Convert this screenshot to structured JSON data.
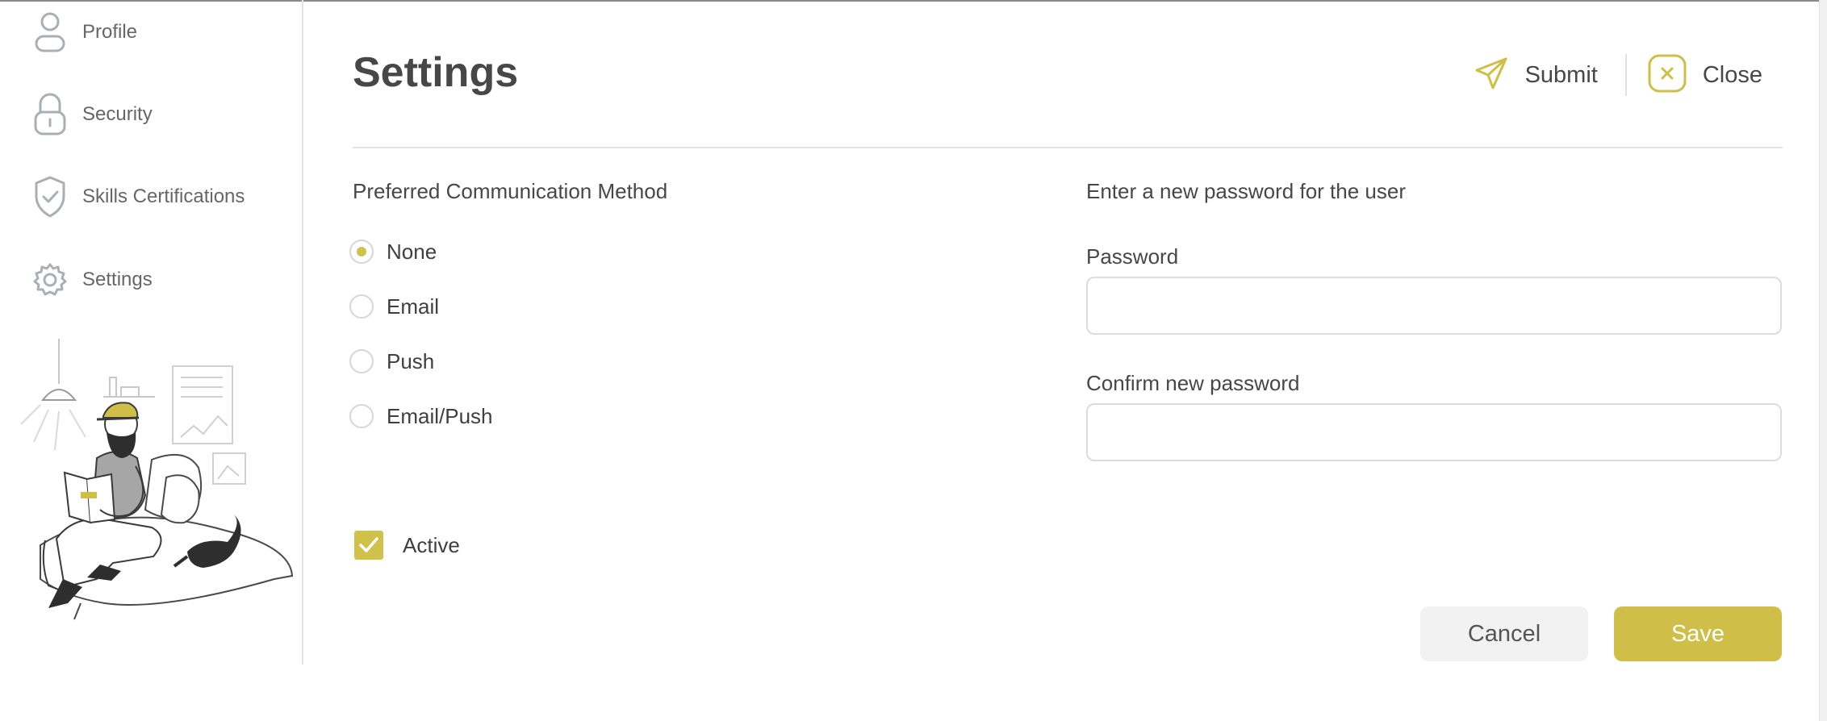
{
  "sidebar": {
    "items": [
      {
        "label": "Profile",
        "icon": "user-icon"
      },
      {
        "label": "Security",
        "icon": "lock-icon"
      },
      {
        "label": "Skills Certifications",
        "icon": "shield-check-icon"
      },
      {
        "label": "Settings",
        "icon": "gear-icon"
      }
    ],
    "illustration": "person-reading-illustration"
  },
  "header": {
    "title": "Settings",
    "submit_label": "Submit",
    "close_label": "Close"
  },
  "communication": {
    "title": "Preferred Communication Method",
    "options": [
      "None",
      "Email",
      "Push",
      "Email/Push"
    ],
    "selected": "None"
  },
  "password": {
    "title": "Enter a new password for the user",
    "password_label": "Password",
    "password_value": "",
    "confirm_label": "Confirm new password",
    "confirm_value": ""
  },
  "active": {
    "label": "Active",
    "checked": true
  },
  "footer": {
    "cancel_label": "Cancel",
    "save_label": "Save"
  },
  "colors": {
    "accent": "#cfbf48",
    "text": "#474747",
    "icon_gray": "#a8b0b6"
  }
}
